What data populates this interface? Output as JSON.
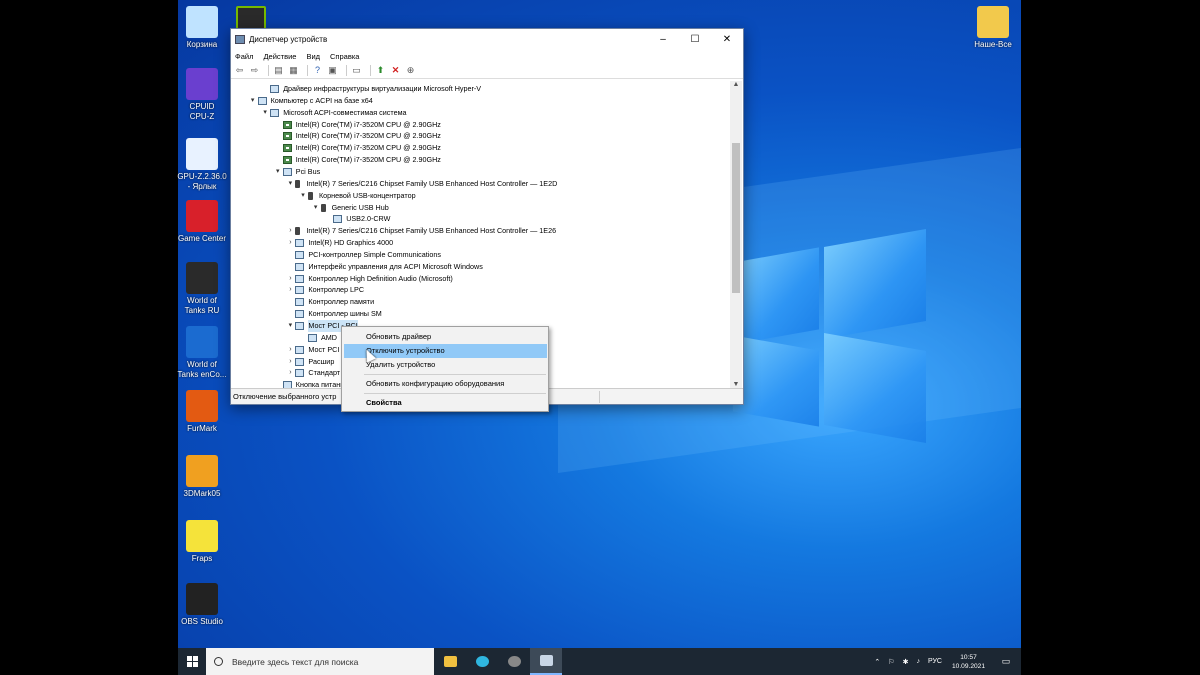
{
  "desktop_icons": [
    {
      "label": "Корзина",
      "icon": "recycle-bin-icon",
      "color": "#bfe3ff"
    },
    {
      "label": "CPUID\nCPU-Z",
      "icon": "cpuz-icon",
      "color": "#6a3fcf"
    },
    {
      "label": "GPU-Z.2.36.0\n- Ярлык",
      "icon": "gpuz-icon",
      "color": "#e8f2ff"
    },
    {
      "label": "Game Center",
      "icon": "game-center-icon",
      "color": "#d8202a"
    },
    {
      "label": "World of\nTanks RU",
      "icon": "wot-icon",
      "color": "#2a2a2a"
    },
    {
      "label": "World of\nTanks enCo...",
      "icon": "wot-encore-icon",
      "color": "#1b6bd0"
    },
    {
      "label": "FurMark",
      "icon": "furmark-icon",
      "color": "#e35a12"
    },
    {
      "label": "3DMark05",
      "icon": "3dmark-icon",
      "color": "#f0a020"
    },
    {
      "label": "Fraps",
      "icon": "fraps-icon",
      "color": "#f5e33a"
    },
    {
      "label": "OBS Studio",
      "icon": "obs-icon",
      "color": "#222222"
    },
    {
      "label": "Наше-Все",
      "icon": "folder-icon",
      "color": "#f2c94c"
    }
  ],
  "window": {
    "title": "Диспетчер устройств",
    "menu": [
      "Файл",
      "Действие",
      "Вид",
      "Справка"
    ],
    "toolbar_icons": [
      "back-icon",
      "forward-icon",
      "properties-icon",
      "list-icon",
      "help-icon",
      "refresh-icon",
      "scan-icon",
      "update-driver-icon",
      "uninstall-icon",
      "download-icon"
    ],
    "status_text": "Отключение выбранного устр",
    "tree": [
      {
        "text": "Драйвер инфраструктуры виртуализации Microsoft Hyper-V",
        "level": 2,
        "exp": "",
        "icon": "sys"
      },
      {
        "text": "Компьютер с ACPI на базе x64",
        "level": 1,
        "exp": "▾",
        "icon": "sys"
      },
      {
        "text": "Microsoft ACPI-совместимая система",
        "level": 2,
        "exp": "▾",
        "icon": "sys"
      },
      {
        "text": "Intel(R) Core(TM) i7-3520M CPU @ 2.90GHz",
        "level": 3,
        "exp": "",
        "icon": "cpu"
      },
      {
        "text": "Intel(R) Core(TM) i7-3520M CPU @ 2.90GHz",
        "level": 3,
        "exp": "",
        "icon": "cpu"
      },
      {
        "text": "Intel(R) Core(TM) i7-3520M CPU @ 2.90GHz",
        "level": 3,
        "exp": "",
        "icon": "cpu"
      },
      {
        "text": "Intel(R) Core(TM) i7-3520M CPU @ 2.90GHz",
        "level": 3,
        "exp": "",
        "icon": "cpu"
      },
      {
        "text": "Pci Bus",
        "level": 3,
        "exp": "▾",
        "icon": "sys"
      },
      {
        "text": "Intel(R) 7 Series/C216 Chipset Family USB Enhanced Host Controller — 1E2D",
        "level": 4,
        "exp": "▾",
        "icon": "usb"
      },
      {
        "text": "Корневой USB-концентратор",
        "level": 5,
        "exp": "▾",
        "icon": "usb"
      },
      {
        "text": "Generic USB Hub",
        "level": 6,
        "exp": "▾",
        "icon": "usb"
      },
      {
        "text": "USB2.0-CRW",
        "level": 7,
        "exp": "",
        "icon": "sys"
      },
      {
        "text": "Intel(R) 7 Series/C216 Chipset Family USB Enhanced Host Controller — 1E26",
        "level": 4,
        "exp": "›",
        "icon": "usb"
      },
      {
        "text": "Intel(R) HD Graphics 4000",
        "level": 4,
        "exp": "›",
        "icon": "sys"
      },
      {
        "text": "PCI-контроллер Simple Communications",
        "level": 4,
        "exp": "",
        "icon": "sys"
      },
      {
        "text": "Интерфейс управления для ACPI Microsoft Windows",
        "level": 4,
        "exp": "",
        "icon": "sys"
      },
      {
        "text": "Контроллер High Definition Audio (Microsoft)",
        "level": 4,
        "exp": "›",
        "icon": "sys"
      },
      {
        "text": "Контроллер LPC",
        "level": 4,
        "exp": "›",
        "icon": "sys"
      },
      {
        "text": "Контроллер памяти",
        "level": 4,
        "exp": "",
        "icon": "sys"
      },
      {
        "text": "Контроллер шины SM",
        "level": 4,
        "exp": "",
        "icon": "sys"
      },
      {
        "text": "Мост PCI - PCI",
        "level": 4,
        "exp": "▾",
        "icon": "sys"
      },
      {
        "text": "AMD",
        "level": 5,
        "exp": "",
        "icon": "sys"
      },
      {
        "text": "Мост PCI",
        "level": 4,
        "exp": "›",
        "icon": "sys"
      },
      {
        "text": "Расшир                                                                    фт)",
        "level": 4,
        "exp": "›",
        "icon": "sys"
      },
      {
        "text": "Стандарт",
        "level": 4,
        "exp": "›",
        "icon": "sys"
      },
      {
        "text": "Кнопка питания",
        "level": 3,
        "exp": "",
        "icon": "sys"
      }
    ]
  },
  "context_menu": {
    "items": [
      "Обновить драйвер",
      "Отключить устройство",
      "Удалить устройство",
      "Обновить конфигурацию оборудования",
      "Свойства"
    ],
    "highlighted_index": 1
  },
  "taskbar": {
    "search_placeholder": "Введите здесь текст для поиска",
    "apps": [
      {
        "icon": "file-explorer-icon",
        "color": "#f0c040"
      },
      {
        "icon": "edge-icon",
        "color": "#2fb6e0"
      },
      {
        "icon": "obs-taskbar-icon",
        "color": "#888888"
      },
      {
        "icon": "device-manager-taskbar-icon",
        "color": "#c8d6e6"
      }
    ],
    "tray_language": "РУС",
    "time": "10:57",
    "date": "10.09.2021"
  }
}
